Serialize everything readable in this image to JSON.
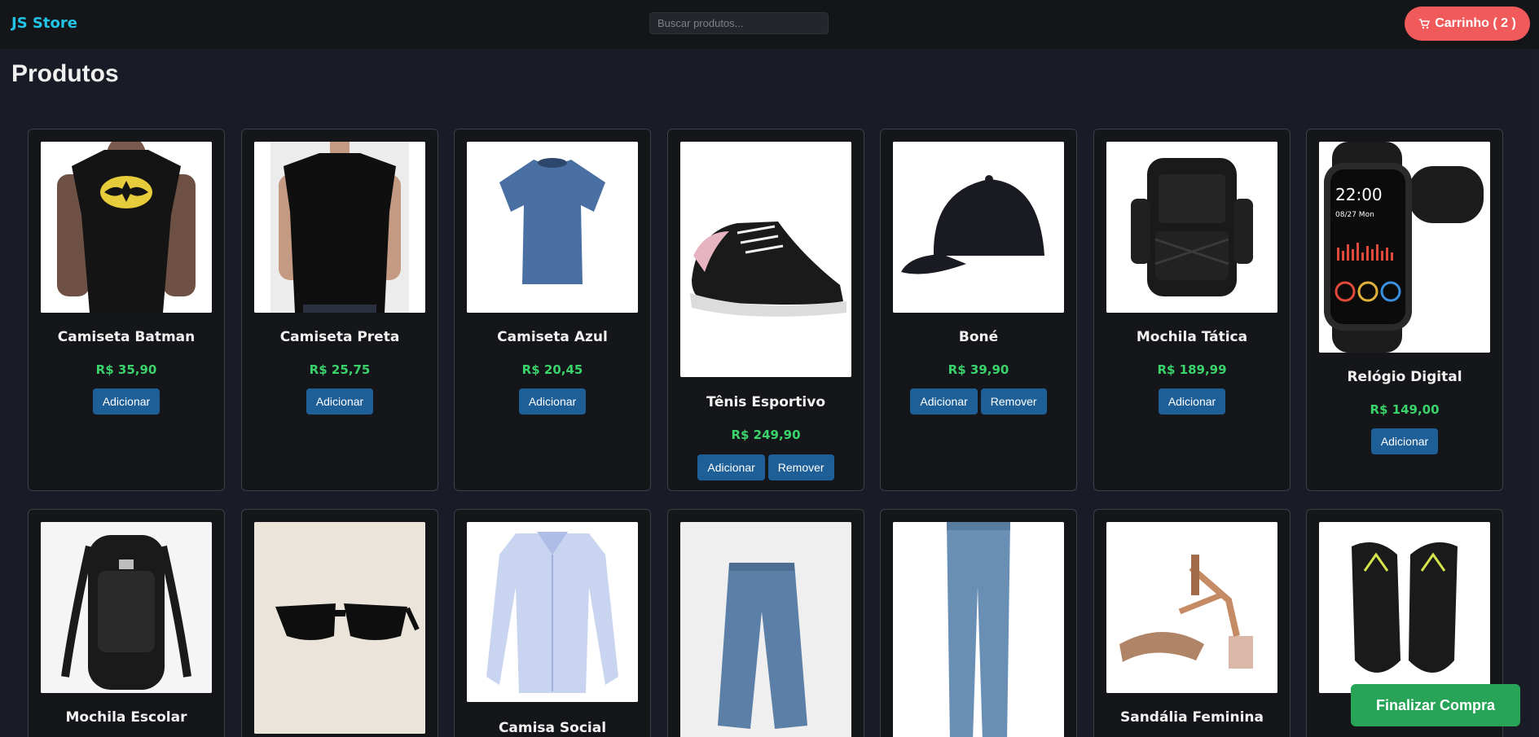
{
  "header": {
    "brand": "JS Store",
    "search_placeholder": "Buscar produtos...",
    "cart_label": "Carrinho ( 2 )",
    "cart_icon": "cart-icon"
  },
  "main": {
    "title": "Produtos",
    "add_label": "Adicionar",
    "remove_label": "Remover",
    "finalize_label": "Finalizar Compra"
  },
  "products": [
    {
      "name": "Camiseta Batman",
      "price": "R$ 35,90"
    },
    {
      "name": "Camiseta Preta",
      "price": "R$ 25,75"
    },
    {
      "name": "Camiseta Azul",
      "price": "R$ 20,45"
    },
    {
      "name": "Tênis Esportivo",
      "price": "R$ 249,90"
    },
    {
      "name": "Boné",
      "price": "R$ 39,90"
    },
    {
      "name": "Mochila Tática",
      "price": "R$ 189,99"
    },
    {
      "name": "Relógio Digital",
      "price": "R$ 149,00"
    },
    {
      "name": "Mochila Escolar"
    },
    {
      "name": ""
    },
    {
      "name": "Camisa Social"
    },
    {
      "name": ""
    },
    {
      "name": ""
    },
    {
      "name": "Sandália Feminina"
    },
    {
      "name": ""
    }
  ],
  "watch": {
    "time": "22:00",
    "date": "08/27 Mon"
  },
  "colors": {
    "accent": "#22c3e6",
    "cart": "#f15a5a",
    "price": "#3ad26a",
    "button": "#1e5f98",
    "finalize": "#27a457"
  }
}
